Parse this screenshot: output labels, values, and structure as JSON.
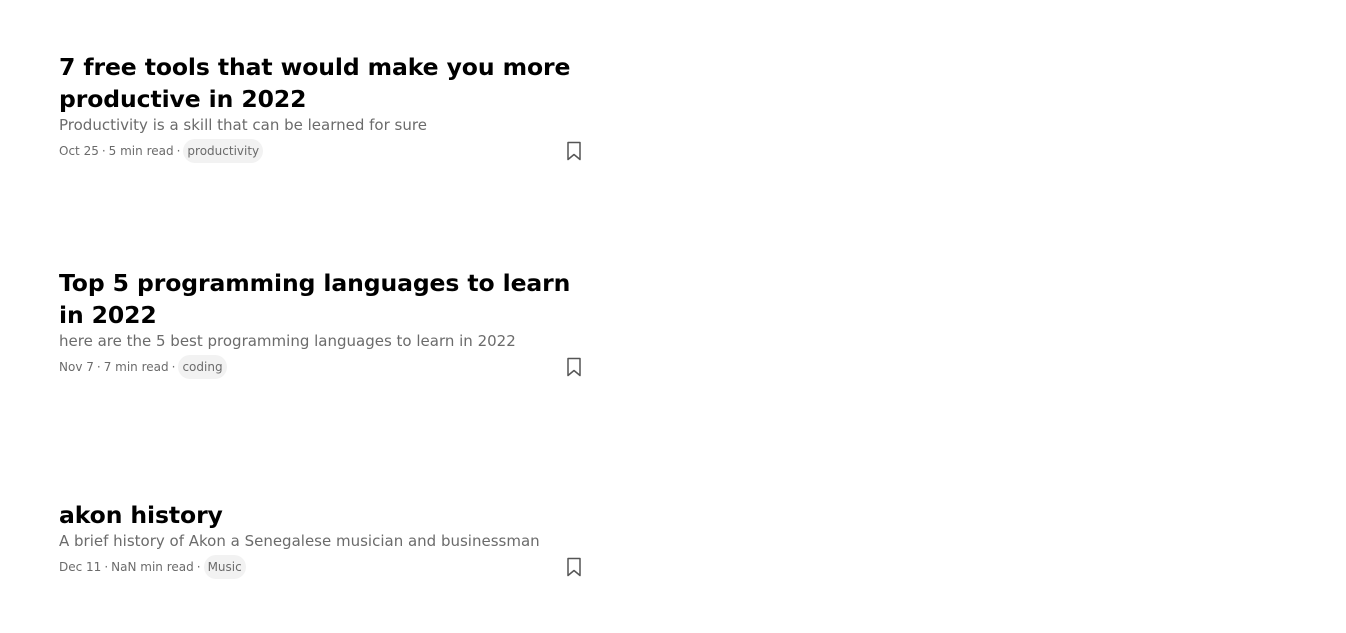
{
  "articles": [
    {
      "title": "7 free tools that would make you more productive in 2022",
      "subtitle": "Productivity is a skill that can be learned for sure",
      "date": "Oct 25",
      "read_time": "5 min read",
      "separator": "·",
      "tag": "productivity",
      "bookmark_icon": "bookmark-icon"
    },
    {
      "title": "Top 5 programming languages to learn in 2022",
      "subtitle": "here are the 5 best programming languages to learn in 2022",
      "date": "Nov 7",
      "read_time": "7 min read",
      "separator": "·",
      "tag": "coding",
      "bookmark_icon": "bookmark-icon"
    },
    {
      "title": "akon history",
      "subtitle": "A brief history of Akon a Senegalese musician and businessman",
      "date": "Dec 11",
      "read_time": "NaN min read",
      "separator": "·",
      "tag": "Music",
      "bookmark_icon": "bookmark-icon"
    }
  ],
  "colors": {
    "title": "#000000",
    "secondary_text": "#6b6b6b",
    "tag_background": "#f2f2f2"
  }
}
